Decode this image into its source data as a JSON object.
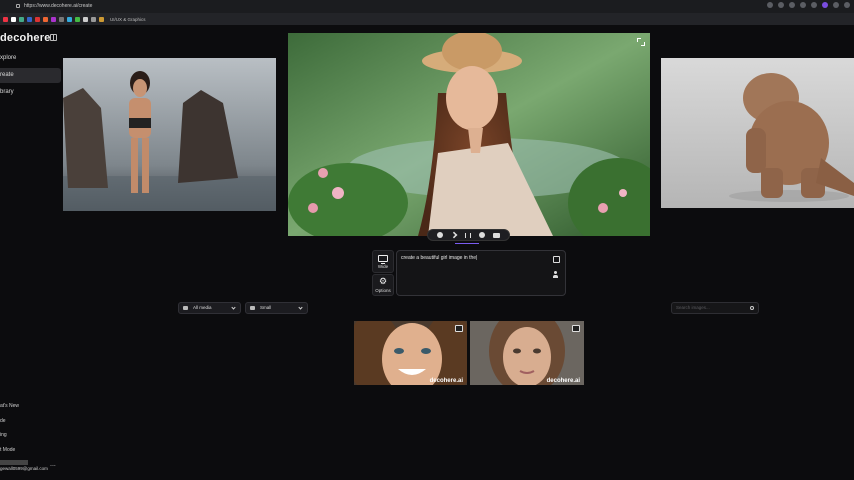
{
  "browser": {
    "url": "https://www.decohere.ai/create",
    "bookmark_folder": "UI/UX & Graphics"
  },
  "sidebar": {
    "logo": "decohere",
    "items": [
      {
        "label": "xplore"
      },
      {
        "label": "reate"
      },
      {
        "label": "brary"
      }
    ],
    "footer": [
      {
        "label": "at's New"
      },
      {
        "label": "de"
      },
      {
        "label": "ing"
      },
      {
        "label": "t Mode"
      }
    ],
    "user_email": "gewall0599@gmail.com",
    "more": "..."
  },
  "prompt": {
    "text": "create a beautiful girl image in the|",
    "aspect_label": "Wide",
    "options_label": "Options"
  },
  "filters": {
    "media": "All media",
    "size": "Small",
    "search_placeholder": "Search images..."
  },
  "thumbnails": [
    {
      "watermark": "decohere.ai"
    },
    {
      "watermark": "decohere.ai"
    }
  ],
  "icons": {
    "collapse": "sidebar-collapse-icon",
    "expand": "expand-icon",
    "aspect": "monitor-icon",
    "options": "gear-icon"
  }
}
